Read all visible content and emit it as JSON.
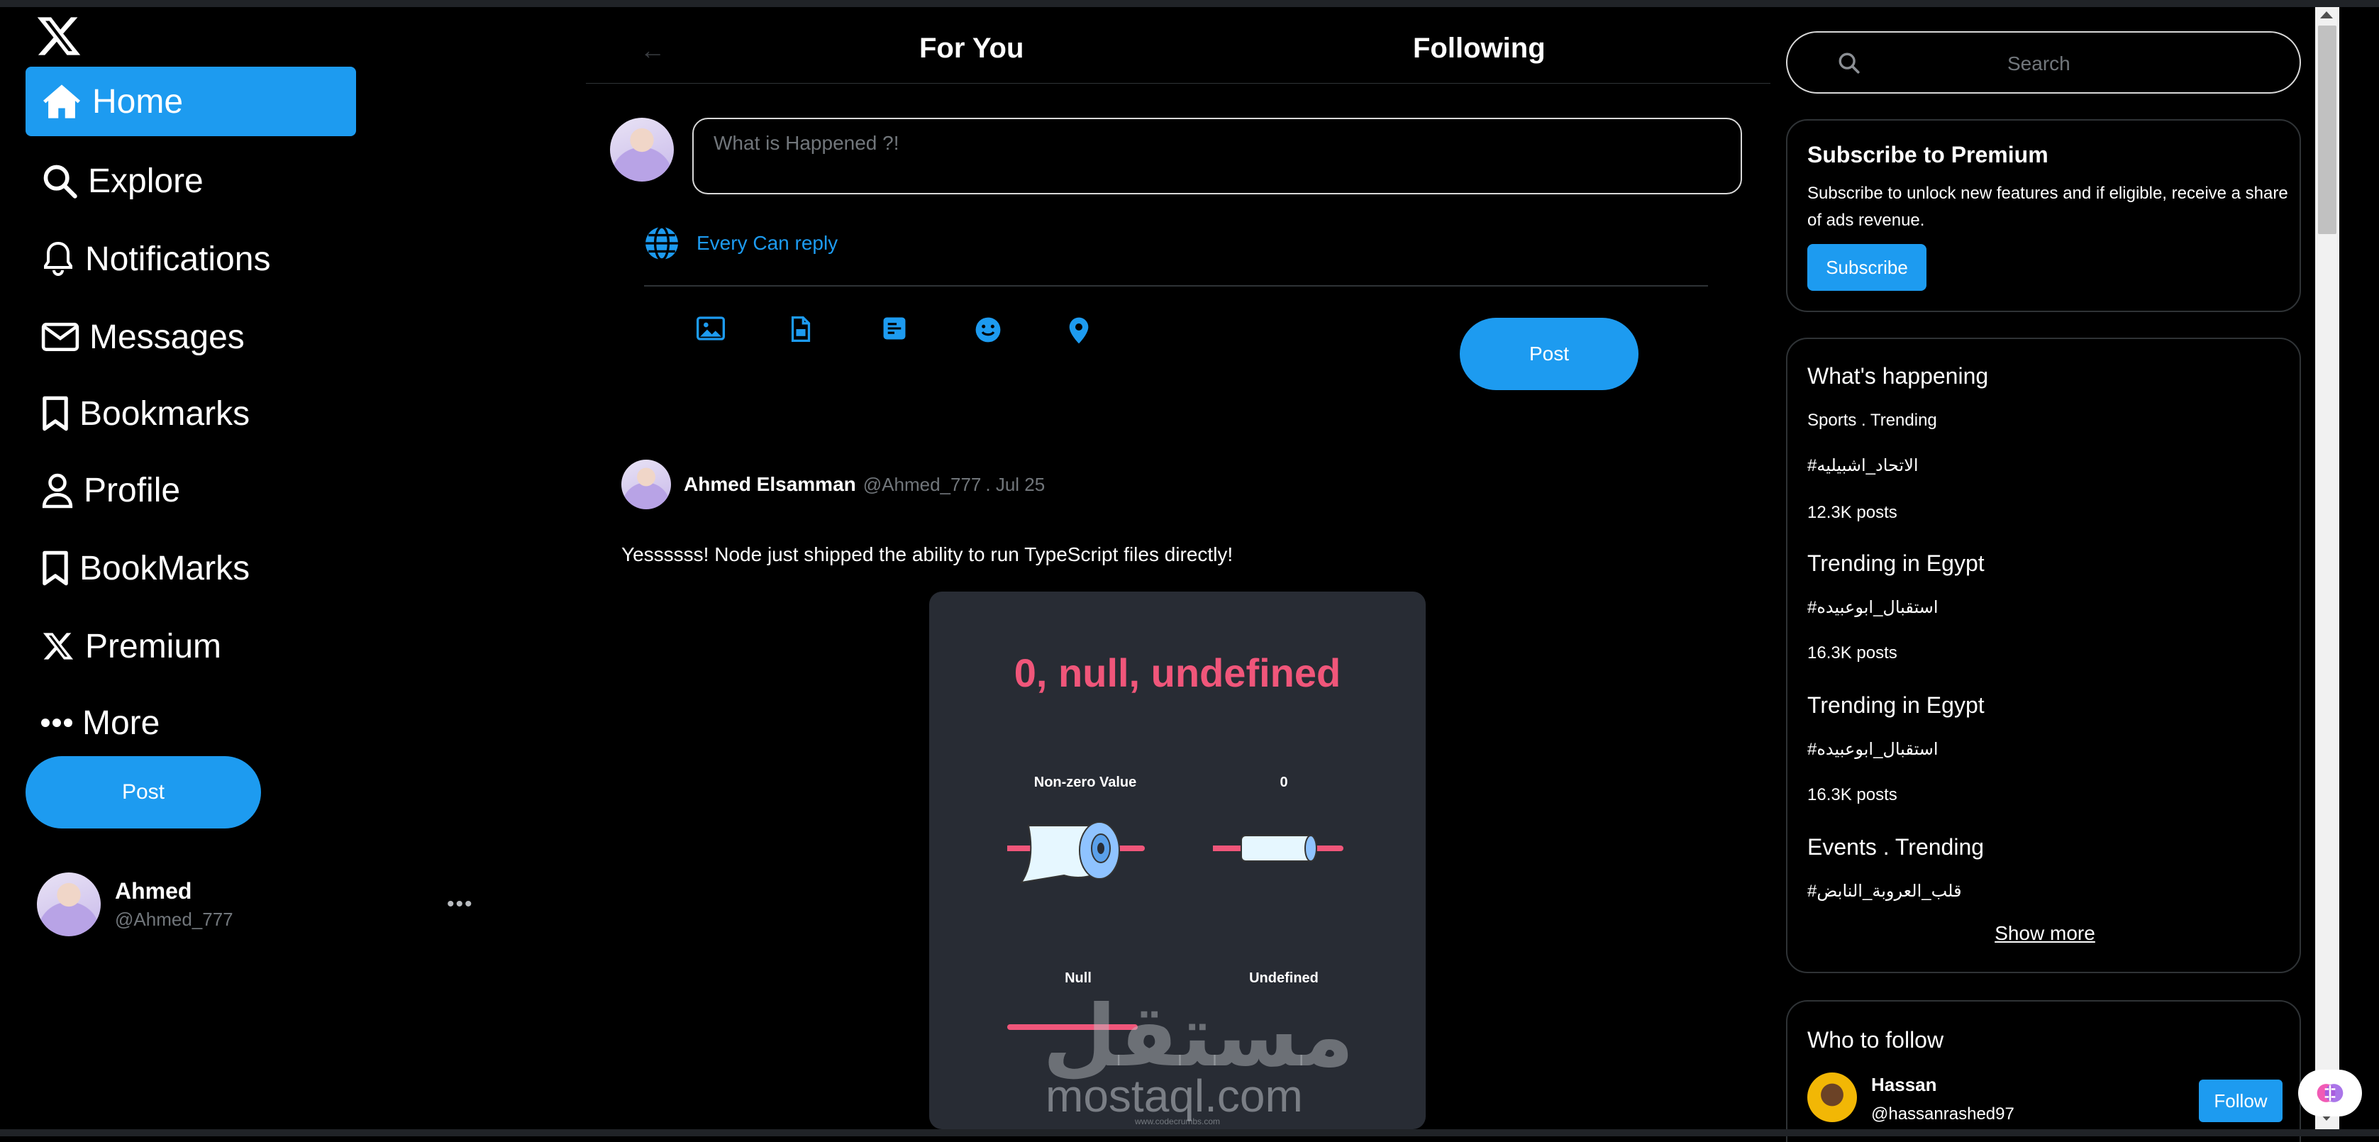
{
  "nav": {
    "items": [
      {
        "label": "Home",
        "icon": "home-icon",
        "active": true
      },
      {
        "label": "Explore",
        "icon": "search-icon"
      },
      {
        "label": "Notifications",
        "icon": "bell-icon"
      },
      {
        "label": "Messages",
        "icon": "mail-icon"
      },
      {
        "label": "Bookmarks",
        "icon": "bookmark-icon"
      },
      {
        "label": "Profile",
        "icon": "user-icon"
      },
      {
        "label": "BookMarks",
        "icon": "bookmark-icon"
      },
      {
        "label": "Premium",
        "icon": "x-logo-icon"
      },
      {
        "label": "More",
        "icon": "ellipsis-icon"
      }
    ],
    "post_label": "Post"
  },
  "account": {
    "name": "Ahmed",
    "handle": "@Ahmed_777",
    "more": "•••"
  },
  "tabs": {
    "for_you": "For You",
    "following": "Following"
  },
  "compose": {
    "placeholder": "What is Happened ?!",
    "reply_setting": "Every Can reply",
    "post_label": "Post",
    "tools": [
      "image-icon",
      "file-icon",
      "poll-icon",
      "emoji-icon",
      "location-icon"
    ]
  },
  "tweet": {
    "name": "Ahmed Elsamman",
    "handle": "@Ahmed_777",
    "date": ". Jul 25",
    "text": "Yessssss! Node just shipped the ability to run TypeScript files directly!",
    "card": {
      "title": "0, null, undefined",
      "labels": [
        "Non-zero Value",
        "0",
        "Null",
        "Undefined"
      ]
    },
    "watermark": {
      "arabic": "مستقل",
      "latin": "mostaql.com",
      "small": "www.codecrumbs.com"
    }
  },
  "search": {
    "placeholder": "Search"
  },
  "premium": {
    "title": "Subscribe to Premium",
    "text": "Subscribe to unlock new features and if eligible, receive a share of ads revenue.",
    "button": "Subscribe"
  },
  "trends": {
    "title": "What's happening",
    "items": [
      {
        "context": "Sports . Trending",
        "tag": "#الاتحاد_اشبيليه",
        "posts": "12.3K posts"
      },
      {
        "context": "Trending in Egypt",
        "tag": "#استقبال_ابوعبيده",
        "posts": "16.3K posts"
      },
      {
        "context": "Trending in Egypt",
        "tag": "#استقبال_ابوعبيده",
        "posts": "16.3K posts"
      },
      {
        "context": "Events . Trending",
        "tag": "#قلب_العروبة_النابض",
        "posts": ""
      }
    ],
    "show_more": "Show more"
  },
  "who_to_follow": {
    "title": "Who to follow",
    "users": [
      {
        "name": "Hassan",
        "handle": "@hassanrashed97",
        "button": "Follow"
      }
    ]
  },
  "colors": {
    "accent": "#1d9bf0",
    "card_title": "#f0567a",
    "background": "#000000"
  }
}
